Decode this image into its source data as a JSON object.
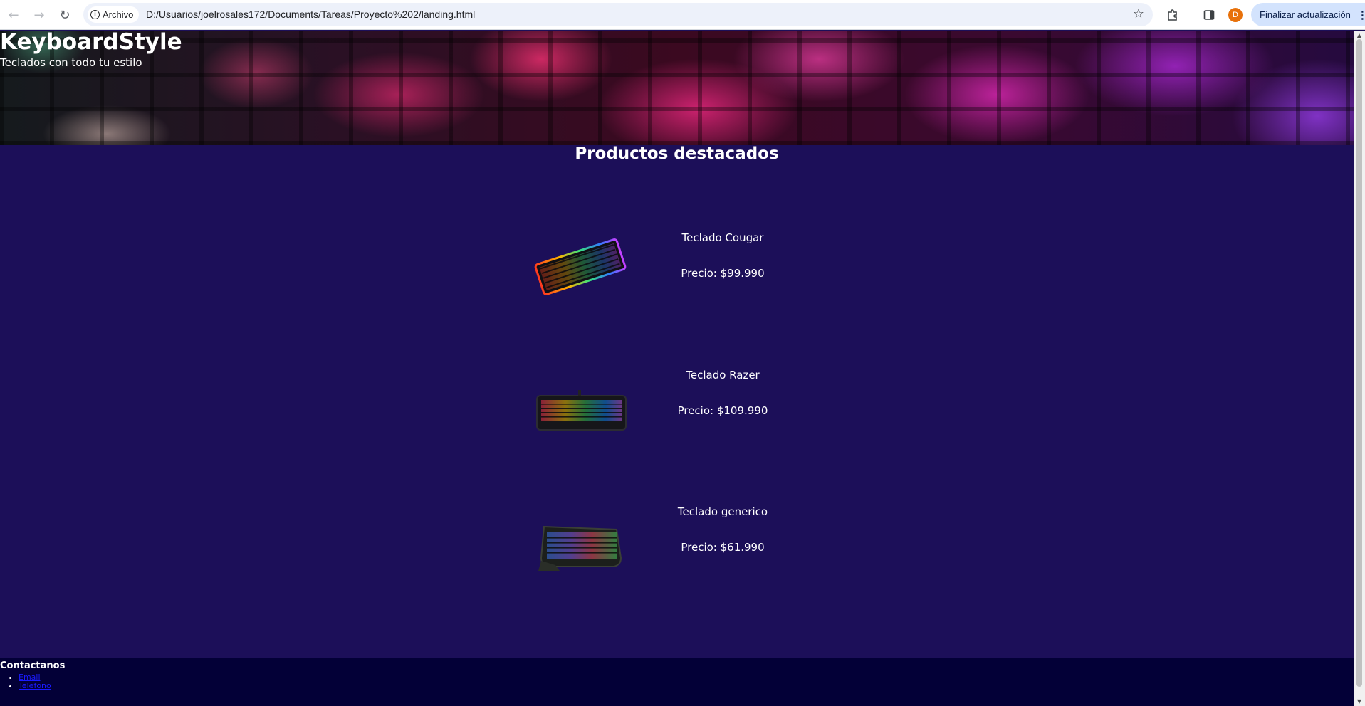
{
  "browser": {
    "back_icon": "←",
    "forward_icon": "→",
    "reload_icon": "↻",
    "site_label": "Archivo",
    "url": "D:/Usuarios/joelrosales172/Documents/Tareas/Proyecto%202/landing.html",
    "profile_initial": "D",
    "update_label": "Finalizar actualización"
  },
  "hero": {
    "brand": "KeyboardStyle",
    "tagline": "Teclados con todo tu estilo"
  },
  "products": {
    "title": "Productos destacados",
    "items": [
      {
        "name": "Teclado Cougar",
        "price": "Precio: $99.990",
        "image": "rgb-keyboard-cougar"
      },
      {
        "name": "Teclado Razer",
        "price": "Precio: $109.990",
        "image": "rgb-keyboard-razer"
      },
      {
        "name": "Teclado generico",
        "price": "Precio: $61.990",
        "image": "rgb-keyboard-generic"
      }
    ]
  },
  "footer": {
    "title": "Contactanos",
    "links": [
      "Email",
      "Telefono"
    ]
  },
  "colors": {
    "page_background": "#1c0f59",
    "footer_background": "#030037",
    "link": "#1a1aff"
  }
}
